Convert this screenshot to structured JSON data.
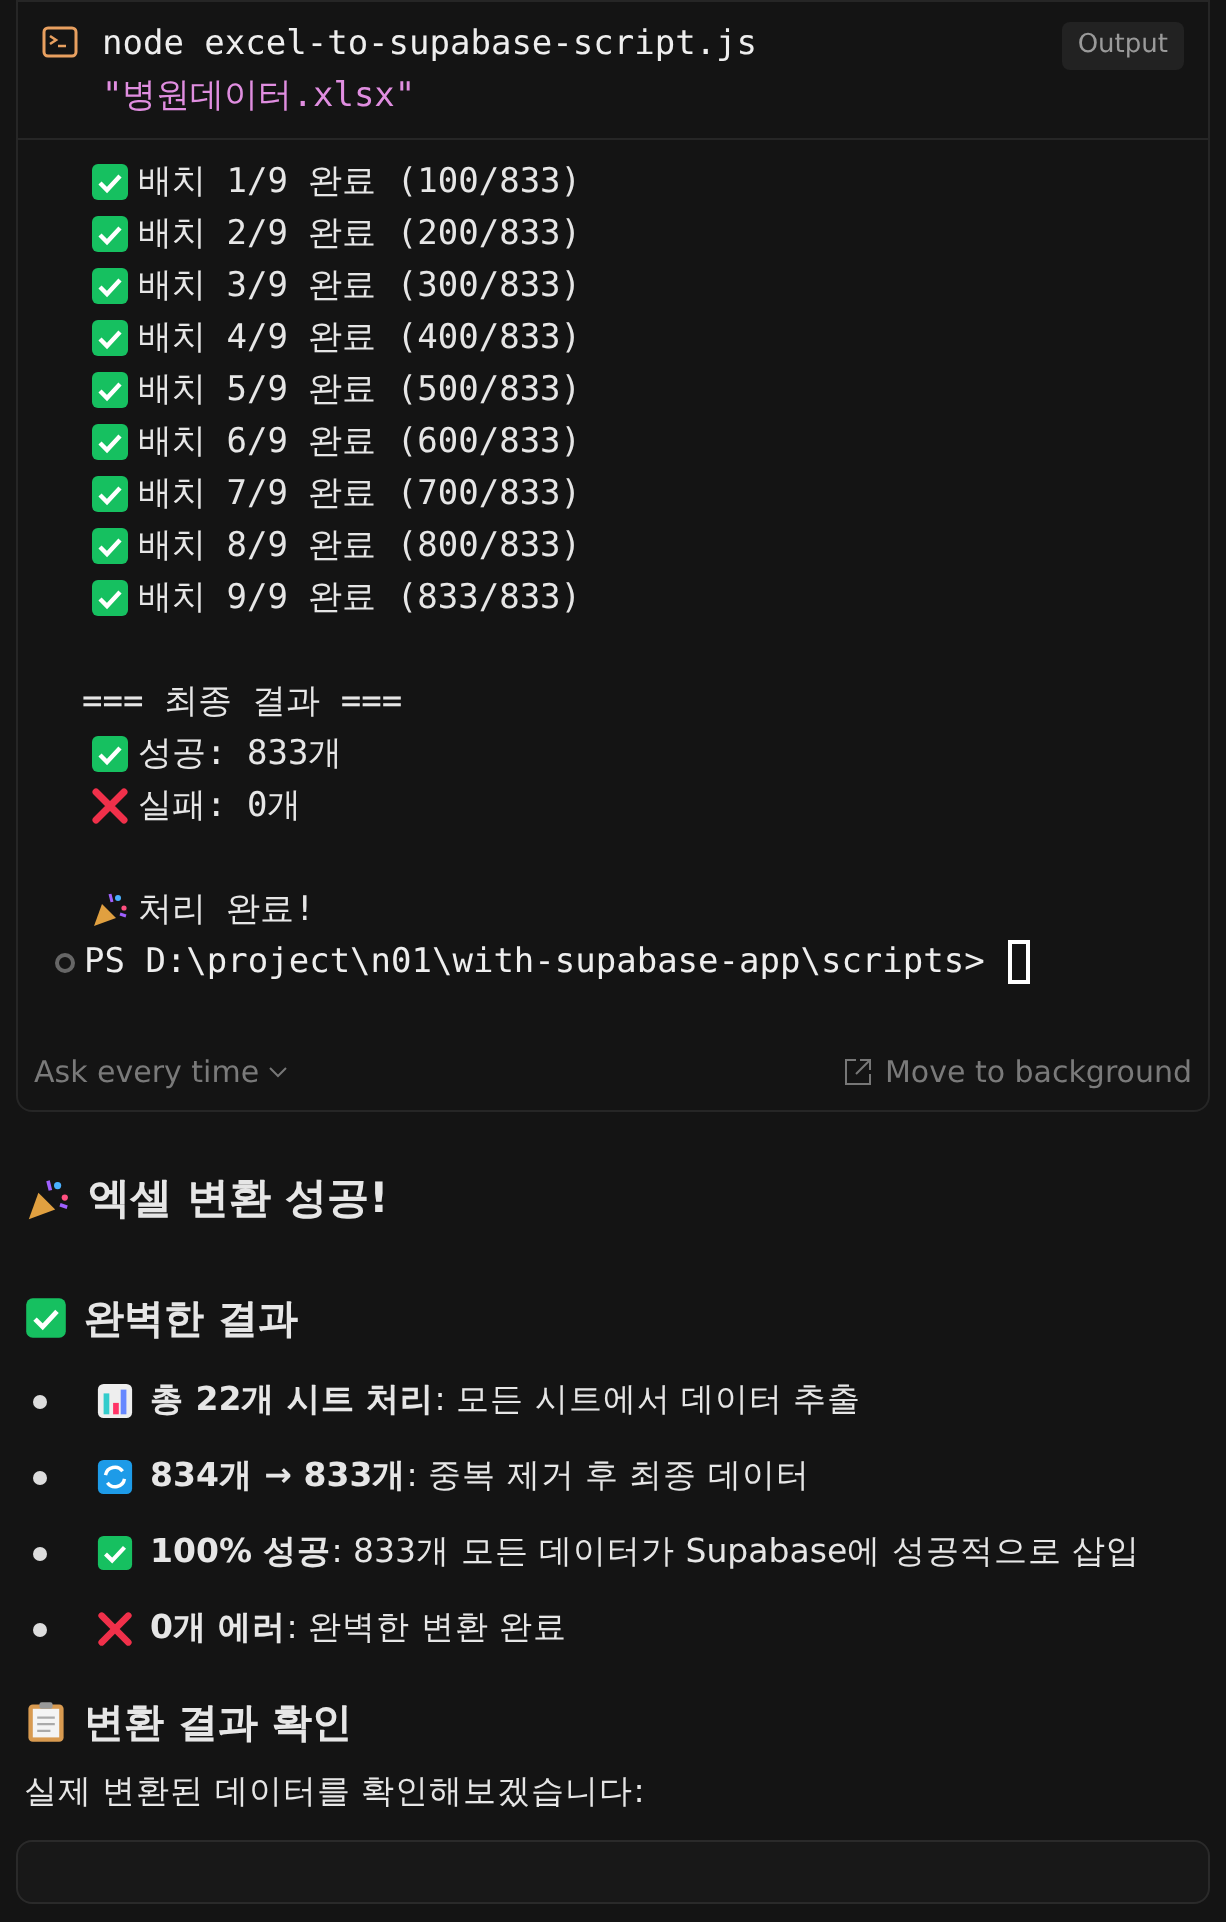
{
  "terminal": {
    "command": "node excel-to-supabase-script.js",
    "argument": "\"병원데이터.xlsx\"",
    "output_button": "Output",
    "lines": [
      {
        "kind": "check",
        "text": "배치 1/9 완료 (100/833)"
      },
      {
        "kind": "check",
        "text": "배치 2/9 완료 (200/833)"
      },
      {
        "kind": "check",
        "text": "배치 3/9 완료 (300/833)"
      },
      {
        "kind": "check",
        "text": "배치 4/9 완료 (400/833)"
      },
      {
        "kind": "check",
        "text": "배치 5/9 완료 (500/833)"
      },
      {
        "kind": "check",
        "text": "배치 6/9 완료 (600/833)"
      },
      {
        "kind": "check",
        "text": "배치 7/9 완료 (700/833)"
      },
      {
        "kind": "check",
        "text": "배치 8/9 완료 (800/833)"
      },
      {
        "kind": "check",
        "text": "배치 9/9 완료 (833/833)"
      },
      {
        "kind": "blank"
      },
      {
        "kind": "plain",
        "text": "=== 최종 결과 ==="
      },
      {
        "kind": "check",
        "text": "성공: 833개"
      },
      {
        "kind": "cross",
        "text": "실패: 0개"
      },
      {
        "kind": "blank"
      },
      {
        "kind": "party",
        "text": "처리 완료!"
      }
    ],
    "prompt": "PS D:\\project\\n01\\with-supabase-app\\scripts>",
    "approval": "Ask every time",
    "move_button": "Move to background"
  },
  "message": [
    {
      "kind": "h1",
      "text": "엑셀 변환 성공!"
    },
    {
      "kind": "h2",
      "text": "완벽한 결과"
    },
    {
      "kind": "bullet",
      "text": "**총 22개 시트 처리**: 모든 시트에서 데이터 추출"
    },
    {
      "kind": "bullet",
      "text": "**834개 → 833개**: 중복 제거 후 최종 데이터"
    },
    {
      "kind": "bullet",
      "text": "**100% 성공**: 833개 모든 데이터가 Supabase에 성공적으로 삽입"
    },
    {
      "kind": "bullet",
      "text": "**0개 에러**: 완벽한 변환 완료"
    },
    {
      "kind": "h2",
      "text": "변환 결과 확인"
    },
    {
      "kind": "para",
      "text": "실제 변환된 데이터를 확인해보겠습니다:"
    }
  ]
}
